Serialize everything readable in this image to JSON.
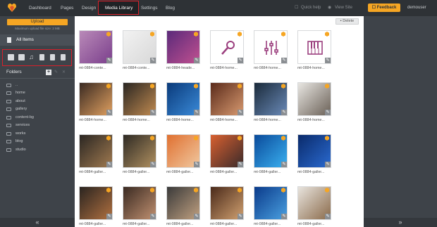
{
  "nav": {
    "items": [
      "Dashboard",
      "Pages",
      "Design",
      "Media Library",
      "Settings",
      "Blog"
    ],
    "active": "Media Library",
    "quick_help": "Quick help",
    "view_site": "View Site",
    "feedback": "Feedback",
    "user": "demouser"
  },
  "sidebar": {
    "upload": "Upload",
    "max_size": "Maximum upload file size: 2 MB",
    "all_items": "All Items",
    "filters": [
      "image-icon",
      "video-icon",
      "music-icon",
      "document-icon",
      "pdf-icon",
      "archive-icon"
    ],
    "folders_title": "Folders",
    "folders": [
      "..",
      "home",
      "about",
      "gallery",
      "content-bg",
      "services",
      "works",
      "blog",
      "studio"
    ]
  },
  "toolbar": {
    "delete": "Delete"
  },
  "media": [
    {
      "caption": "mt-0884-conte...",
      "kind": "photo",
      "colors": [
        "#b98ab8",
        "#7b3f8c"
      ]
    },
    {
      "caption": "mt-0884-conte...",
      "kind": "photo",
      "colors": [
        "#f2f2f2",
        "#d8d8d8"
      ]
    },
    {
      "caption": "mt-0884-heade...",
      "kind": "photo",
      "colors": [
        "#5b2a7a",
        "#c05090"
      ]
    },
    {
      "caption": "mt-0884-home...",
      "kind": "icon-mic",
      "colors": [
        "#ffffff",
        "#ffffff"
      ]
    },
    {
      "caption": "mt-0884-home...",
      "kind": "icon-sliders",
      "colors": [
        "#ffffff",
        "#ffffff"
      ]
    },
    {
      "caption": "mt-0884-home...",
      "kind": "icon-keyboard",
      "colors": [
        "#ffffff",
        "#ffffff"
      ]
    },
    {
      "caption": "mt-0884-home...",
      "kind": "photo",
      "colors": [
        "#3a2a22",
        "#e0a060"
      ]
    },
    {
      "caption": "mt-0884-home...",
      "kind": "photo",
      "colors": [
        "#2a2622",
        "#c08a50"
      ]
    },
    {
      "caption": "mt-0884-home...",
      "kind": "photo",
      "colors": [
        "#0a3a7a",
        "#3a8ad8"
      ]
    },
    {
      "caption": "mt-0884-home...",
      "kind": "photo",
      "colors": [
        "#5a2a1a",
        "#d89a70"
      ]
    },
    {
      "caption": "mt-0884-home...",
      "kind": "photo",
      "colors": [
        "#1a2a3a",
        "#6a8ab8"
      ]
    },
    {
      "caption": "mt-0884-home...",
      "kind": "photo",
      "colors": [
        "#e8e6e2",
        "#6a6056"
      ]
    },
    {
      "caption": "mt-0884-galler...",
      "kind": "photo",
      "colors": [
        "#2a2622",
        "#a07a50"
      ]
    },
    {
      "caption": "mt-0884-galler...",
      "kind": "photo",
      "colors": [
        "#2e2a24",
        "#b09060"
      ]
    },
    {
      "caption": "mt-0884-galler...",
      "kind": "photo",
      "colors": [
        "#e07030",
        "#f0c8a0"
      ]
    },
    {
      "caption": "mt-0884-galler...",
      "kind": "photo",
      "colors": [
        "#d86030",
        "#3a2a2a"
      ]
    },
    {
      "caption": "mt-0884-galler...",
      "kind": "photo",
      "colors": [
        "#0a4a9a",
        "#3ab0f0"
      ]
    },
    {
      "caption": "mt-0884-galler...",
      "kind": "photo",
      "colors": [
        "#0a2a6a",
        "#2a6ad0"
      ]
    },
    {
      "caption": "mt-0884-galler...",
      "kind": "photo",
      "colors": [
        "#2a2420",
        "#b07040"
      ]
    },
    {
      "caption": "mt-0884-galler...",
      "kind": "photo",
      "colors": [
        "#3a2a22",
        "#c09070"
      ]
    },
    {
      "caption": "mt-0884-galler...",
      "kind": "photo",
      "colors": [
        "#3a3a3a",
        "#c0a080"
      ]
    },
    {
      "caption": "mt-0884-galler...",
      "kind": "photo",
      "colors": [
        "#4a2a1a",
        "#d0a070"
      ]
    },
    {
      "caption": "mt-0884-galler...",
      "kind": "photo",
      "colors": [
        "#0a3a8a",
        "#4aa0e0"
      ]
    },
    {
      "caption": "mt-0884-galler...",
      "kind": "photo",
      "colors": [
        "#e8e4de",
        "#8a6a4a"
      ]
    }
  ],
  "pager": {
    "left": "«",
    "right": "»"
  }
}
